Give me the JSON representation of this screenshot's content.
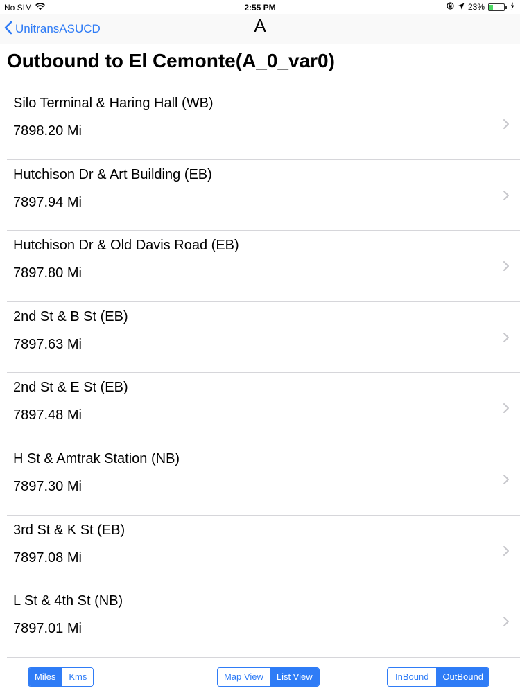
{
  "status_bar": {
    "carrier": "No SIM",
    "time": "2:55 PM",
    "battery_percent": "23%",
    "battery_level": 0.23,
    "icons": [
      "wifi-icon",
      "lock-rotation-icon",
      "location-arrow-icon",
      "battery-icon",
      "charging-bolt-icon"
    ]
  },
  "nav": {
    "back_label": "UnitransASUCD",
    "title": "A"
  },
  "page": {
    "title": "Outbound to El Cemonte(A_0_var0)"
  },
  "stops": [
    {
      "name": "Silo Terminal & Haring Hall (WB)",
      "distance": "7898.20 Mi"
    },
    {
      "name": "Hutchison Dr & Art Building (EB)",
      "distance": "7897.94 Mi"
    },
    {
      "name": "Hutchison Dr & Old Davis Road (EB)",
      "distance": "7897.80 Mi"
    },
    {
      "name": "2nd St & B St (EB)",
      "distance": "7897.63 Mi"
    },
    {
      "name": "2nd St & E St (EB)",
      "distance": "7897.48 Mi"
    },
    {
      "name": "H St & Amtrak Station (NB)",
      "distance": "7897.30 Mi"
    },
    {
      "name": "3rd St & K St (EB)",
      "distance": "7897.08 Mi"
    },
    {
      "name": "L St & 4th St (NB)",
      "distance": "7897.01 Mi"
    }
  ],
  "toolbar": {
    "units": {
      "miles": "Miles",
      "kms": "Kms",
      "selected": "miles"
    },
    "view": {
      "map": "Map View",
      "list": "List View",
      "selected": "list"
    },
    "direction": {
      "inbound": "InBound",
      "outbound": "OutBound",
      "selected": "outbound"
    }
  },
  "colors": {
    "accent": "#2f7cf6",
    "separator": "#d6d6da",
    "chevron": "#c7c7cc"
  }
}
